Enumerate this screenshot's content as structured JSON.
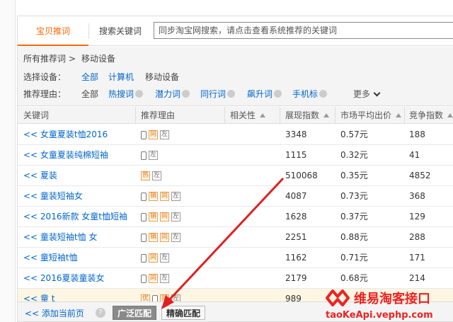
{
  "tabs": [
    {
      "label": "宝贝推词",
      "active": true
    },
    {
      "label": "搜索关键词",
      "active": false
    }
  ],
  "search": {
    "placeholder": "同步淘宝网搜索，请点击查看系统推荐的关键词",
    "value": ""
  },
  "breadcrumb": {
    "root": "所有推荐词",
    "sep": ">",
    "current": "移动设备"
  },
  "device_filter": {
    "label": "选择设备：",
    "options": [
      "全部",
      "计算机",
      "移动设备"
    ],
    "selected": "移动设备"
  },
  "reason_filter": {
    "label": "推荐理由：",
    "options": [
      "全部",
      "热搜词",
      "潜力词",
      "同行词",
      "飙升词",
      "手机标"
    ],
    "more": "更多"
  },
  "table": {
    "headers": {
      "keyword": "关键词",
      "reason": "推荐理由",
      "relevance": "相关性",
      "impressions": "展现指数",
      "avg_bid": "市场平均出价",
      "competition": "竞争指数"
    },
    "rows": [
      {
        "keyword": "<< 女童夏装t恤2016",
        "tags": [
          "phone",
          "同",
          "左"
        ],
        "impressions": "3348",
        "avg_bid": "0.57元",
        "competition": "188"
      },
      {
        "keyword": "<< 女童夏装纯棉短袖",
        "tags": [
          "phone",
          "左"
        ],
        "impressions": "1115",
        "avg_bid": "0.32元",
        "competition": "41"
      },
      {
        "keyword": "<< 夏装",
        "tags": [
          "热",
          "左"
        ],
        "impressions": "510068",
        "avg_bid": "0.35元",
        "competition": "4852"
      },
      {
        "keyword": "<< 童装短袖女",
        "tags": [
          "phone",
          "销",
          "同",
          "左"
        ],
        "impressions": "4087",
        "avg_bid": "0.73元",
        "competition": "368"
      },
      {
        "keyword": "<< 2016新款 女童t恤短袖",
        "tags": [
          "phone",
          "销",
          "同",
          "左"
        ],
        "impressions": "1628",
        "avg_bid": "0.37元",
        "competition": "129"
      },
      {
        "keyword": "<< 童装短袖t恤 女",
        "tags": [
          "phone",
          "销",
          "同",
          "左"
        ],
        "impressions": "2251",
        "avg_bid": "0.88元",
        "competition": "288"
      },
      {
        "keyword": "<< 童短袖t恤",
        "tags": [
          "phone",
          "同",
          "左"
        ],
        "impressions": "1162",
        "avg_bid": "0.71元",
        "competition": "171"
      },
      {
        "keyword": "<< 2016夏装童装女",
        "tags": [
          "phone",
          "同",
          "左"
        ],
        "impressions": "2179",
        "avg_bid": "0.68元",
        "competition": "214"
      },
      {
        "keyword": "<< 童 t",
        "tags": [
          "优",
          "phone",
          "同",
          "左"
        ],
        "impressions": "989",
        "avg_bid": "",
        "competition": ""
      }
    ]
  },
  "footer": {
    "add_label": "<< 添加当前页",
    "help": "?",
    "broad_match": "广泛匹配",
    "exact_match": "精确匹配"
  },
  "watermark": {
    "title": "维易淘客接口",
    "url": "taoKeApi.vephp.com"
  },
  "colors": {
    "accent": "#ff6600",
    "link": "#0066cc",
    "relevance_bar": "#f0a040",
    "arrow": "#e02020",
    "watermark": "#ee2222"
  }
}
